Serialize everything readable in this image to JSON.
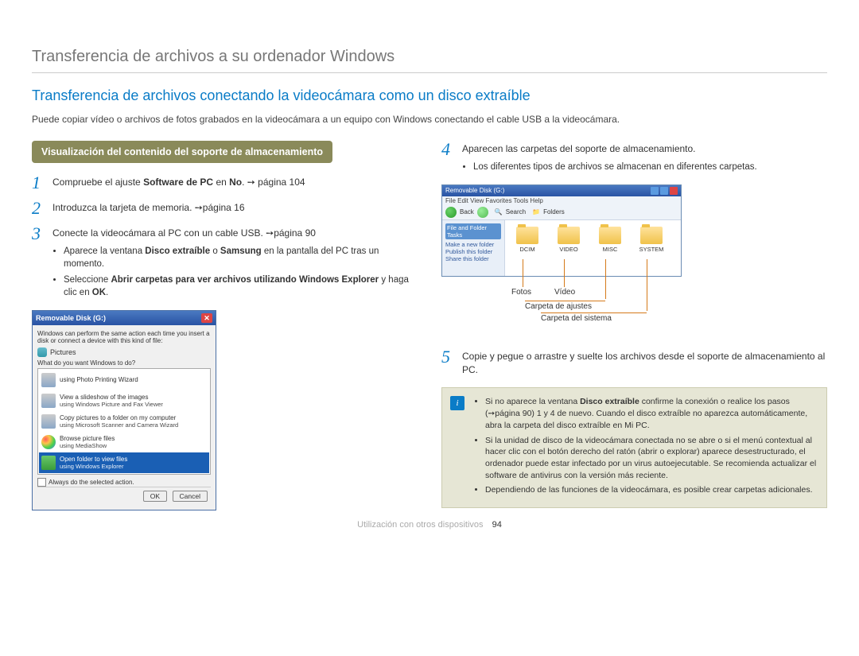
{
  "page_title": "Transferencia de archivos a su ordenador Windows",
  "section_title": "Transferencia de archivos conectando la videocámara como un disco extraíble",
  "intro": "Puede copiar vídeo o archivos de fotos grabados en la videocámara a un equipo con Windows conectando el cable USB a la videocámara.",
  "sub_heading": "Visualización del contenido del soporte de almacenamiento",
  "steps": {
    "s1": {
      "num": "1",
      "text_a": "Compruebe el ajuste ",
      "bold": "Software de PC",
      "text_b": " en ",
      "bold2": "No",
      "text_c": ". ➙ página 104"
    },
    "s2": {
      "num": "2",
      "text": "Introduzca la tarjeta de memoria. ➙página 16"
    },
    "s3": {
      "num": "3",
      "text": "Conecte la videocámara al PC con un cable USB. ➙página 90",
      "bul1_a": "Aparece la ventana ",
      "bul1_bold": "Disco extraíble",
      "bul1_b": " o ",
      "bul1_bold2": "Samsung",
      "bul1_c": " en la pantalla del PC tras un momento.",
      "bul2_a": "Seleccione ",
      "bul2_bold": "Abrir carpetas para ver archivos utilizando Windows Explorer",
      "bul2_b": " y haga clic en ",
      "bul2_bold2": "OK",
      "bul2_c": "."
    },
    "s4": {
      "num": "4",
      "text": "Aparecen las carpetas del soporte de almacenamiento.",
      "bul1": "Los diferentes tipos de archivos se almacenan en diferentes carpetas."
    },
    "s5": {
      "num": "5",
      "text": "Copie y pegue o arrastre y suelte los archivos desde el soporte de almacenamiento al PC."
    }
  },
  "xp_dialog": {
    "title": "Removable Disk (G:)",
    "desc": "Windows can perform the same action each time you insert a disk or connect a device with this kind of file:",
    "pic_label": "Pictures",
    "prompt": "What do you want Windows to do?",
    "opts": [
      {
        "t1": "using Photo Printing Wizard",
        "t2": ""
      },
      {
        "t1": "View a slideshow of the images",
        "t2": "using Windows Picture and Fax Viewer"
      },
      {
        "t1": "Copy pictures to a folder on my computer",
        "t2": "using Microsoft Scanner and Camera Wizard"
      },
      {
        "t1": "Browse picture files",
        "t2": "using MediaShow"
      },
      {
        "t1": "Open folder to view files",
        "t2": "using Windows Explorer"
      }
    ],
    "check": "Always do the selected action.",
    "ok": "OK",
    "cancel": "Cancel"
  },
  "explorer": {
    "title": "Removable Disk (G:)",
    "menu": "File   Edit   View   Favorites   Tools   Help",
    "tb_back": "Back",
    "tb_search": "Search",
    "tb_folders": "Folders",
    "side_head": "File and Folder Tasks",
    "side1": "Make a new folder",
    "side2": "Publish this folder",
    "side3": "Share this folder",
    "folders": [
      {
        "name": "DCIM"
      },
      {
        "name": "VIDEO"
      },
      {
        "name": "MISC"
      },
      {
        "name": "SYSTEM"
      }
    ]
  },
  "callouts": {
    "fotos": "Fotos",
    "video": "Vídeo",
    "ajustes": "Carpeta de ajustes",
    "sistema": "Carpeta del sistema"
  },
  "info": {
    "bul1_a": "Si no aparece la ventana ",
    "bul1_bold": "Disco extraíble",
    "bul1_b": " confirme la conexión o realice los pasos (➙página 90) 1 y 4 de nuevo. Cuando el disco extraíble no aparezca automáticamente, abra la carpeta del disco extraíble en Mi PC.",
    "bul2": "Si la unidad de disco de la videocámara conectada no se abre o si el menú contextual al hacer clic con el botón derecho del ratón (abrir o explorar) aparece desestructurado, el ordenador puede estar infectado por un virus autoejecutable. Se recomienda actualizar el software de antivirus con la versión más reciente.",
    "bul3": "Dependiendo de las funciones de la videocámara, es posible crear carpetas adicionales."
  },
  "footer_text": "Utilización con otros dispositivos",
  "page_num": "94"
}
